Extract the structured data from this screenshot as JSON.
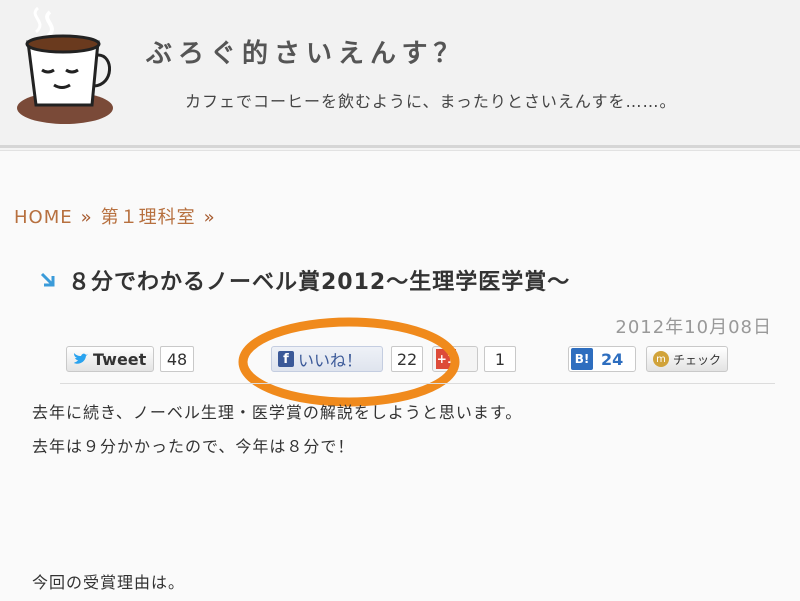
{
  "header": {
    "site_title": "ぶろぐ的さいえんす？",
    "tagline": "カフェでコーヒーを飲むように、まったりとさいえんすを……。"
  },
  "breadcrumb": {
    "home": "HOME",
    "separator": "»",
    "category": "第１理科室"
  },
  "post": {
    "title": "８分でわかるノーベル賞2012〜生理学医学賞〜",
    "date": "2012年10月08日",
    "paragraph1": "去年に続き、ノーベル生理・医学賞の解説をしようと思います。",
    "paragraph2": "去年は９分かかったので、今年は８分で！",
    "paragraph3": "今回の受賞理由は。"
  },
  "social": {
    "tweet_label": "Tweet",
    "tweet_count": "48",
    "like_icon": "f",
    "like_label": "いいね！",
    "like_count": "22",
    "gplus_label": "+1",
    "gplus_count": "1",
    "hatena_label": "B!",
    "hatena_count": "24",
    "mixi_icon": "m",
    "check_label": "チェック"
  },
  "colors": {
    "accent": "#b7703f",
    "highlight_ring": "#f08a1c",
    "facebook": "#3b5998",
    "hatena": "#2e6ebf"
  }
}
